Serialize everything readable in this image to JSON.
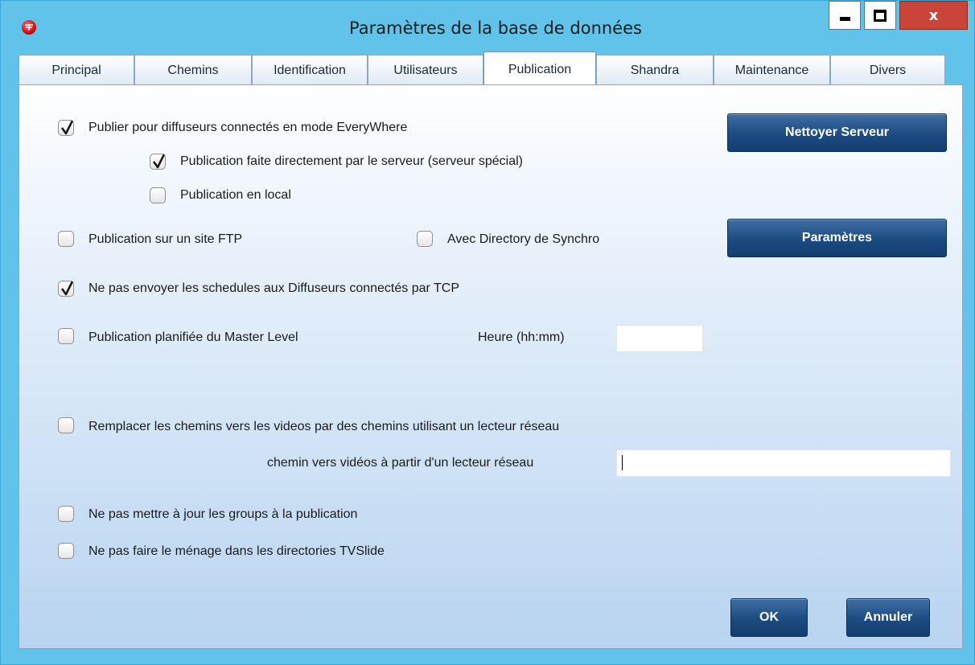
{
  "window": {
    "title": "Paramètres de la base de données",
    "close_glyph": "x",
    "icons": [
      "app-logo-icon",
      "minimize-icon",
      "maximize-icon",
      "close-icon"
    ]
  },
  "tabs": [
    {
      "label": "Principal",
      "active": false
    },
    {
      "label": "Chemins",
      "active": false
    },
    {
      "label": "Identification",
      "active": false
    },
    {
      "label": "Utilisateurs",
      "active": false
    },
    {
      "label": "Publication",
      "active": true
    },
    {
      "label": "Shandra",
      "active": false
    },
    {
      "label": "Maintenance",
      "active": false
    },
    {
      "label": "Divers",
      "active": false
    }
  ],
  "options": {
    "everywhere": {
      "label": "Publier pour diffuseurs connectés en mode EveryWhere",
      "checked": true
    },
    "server_direct": {
      "label": "Publication faite directement par le serveur (serveur spécial)",
      "checked": true
    },
    "local": {
      "label": "Publication en local",
      "checked": false
    },
    "ftp": {
      "label": "Publication sur un site FTP",
      "checked": false
    },
    "sync_dir": {
      "label": "Avec Directory de Synchro",
      "checked": false
    },
    "no_schedules": {
      "label": "Ne pas envoyer les schedules aux Diffuseurs connectés par TCP",
      "checked": true
    },
    "master_level": {
      "label": "Publication planifiée du Master Level",
      "checked": false
    },
    "network_paths": {
      "label": "Remplacer les chemins vers les videos par des chemins utilisant un lecteur réseau",
      "checked": false
    },
    "no_groups": {
      "label": "Ne pas mettre à jour les groups à la publication",
      "checked": false
    },
    "no_cleanup": {
      "label": "Ne pas faire le ménage dans les directories TVSlide",
      "checked": false
    }
  },
  "fields": {
    "time_label": "Heure (hh:mm)",
    "time_value": "",
    "network_path_label": "chemin vers vidéos à partir d'un lecteur réseau",
    "network_path_value": ""
  },
  "buttons": {
    "clean_server": "Nettoyer Serveur",
    "settings": "Paramètres",
    "ok": "OK",
    "cancel": "Annuler"
  },
  "colors": {
    "frame": "#62c3ea",
    "button_blue": "#1c4b82",
    "close_red": "#c9453a"
  }
}
